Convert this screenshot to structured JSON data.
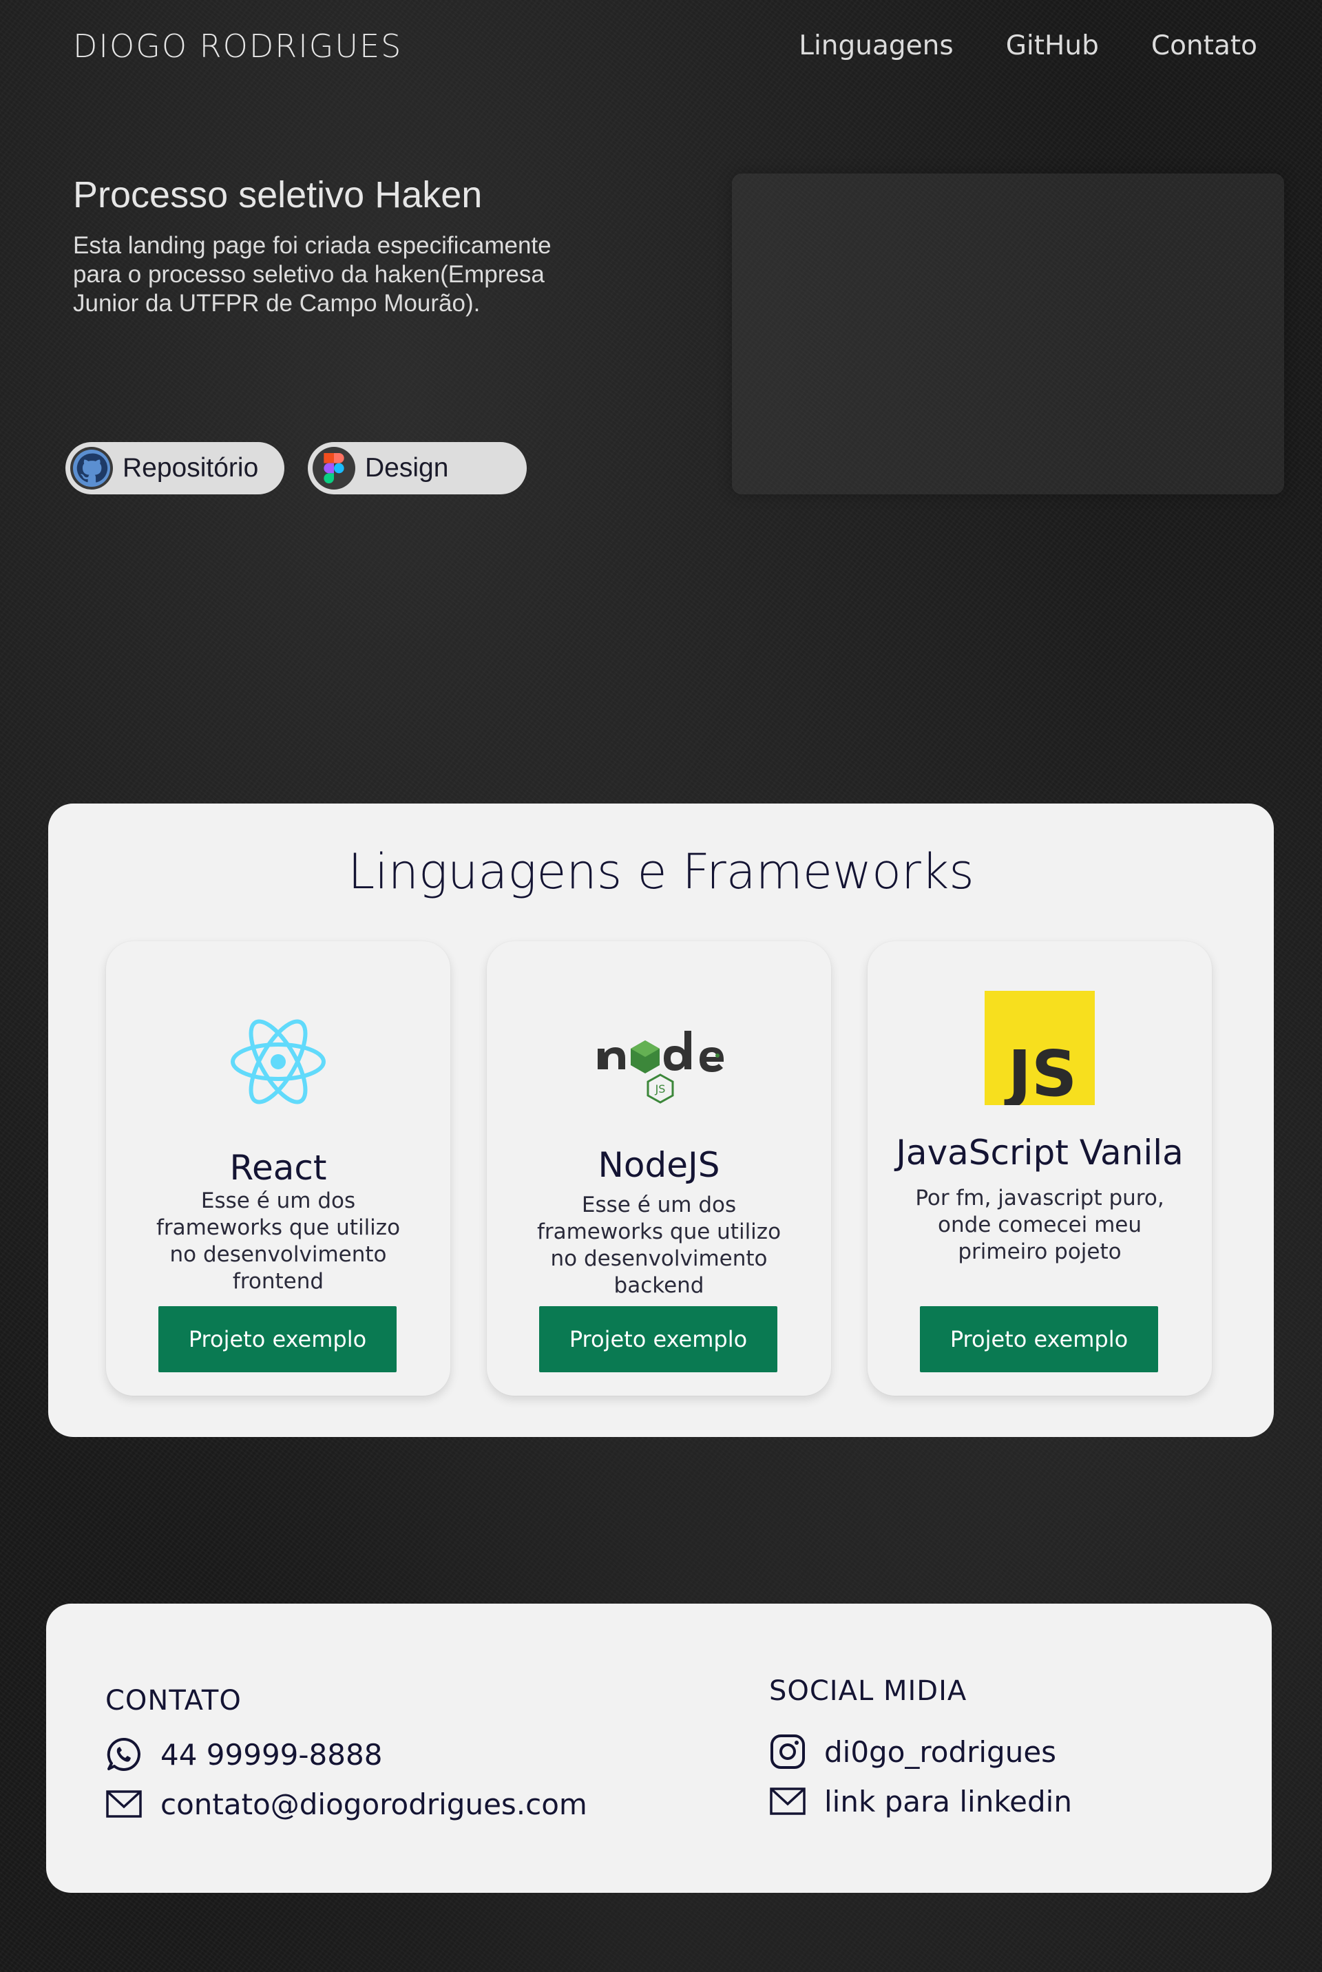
{
  "header": {
    "brand": "DIOGO  RODRIGUES",
    "nav": [
      "Linguagens",
      "GitHub",
      "Contato"
    ]
  },
  "hero": {
    "title": "Processo seletivo Haken",
    "text": "Esta landing page foi criada especificamente para o processo seletivo da haken(Empresa Junior da UTFPR de Campo Mourão).",
    "buttons": [
      {
        "label": "Repositório",
        "icon": "github-icon"
      },
      {
        "label": "Design",
        "icon": "figma-icon"
      }
    ]
  },
  "languages": {
    "title": "Linguagens e Frameworks",
    "cards": [
      {
        "name": "React",
        "icon": "react-icon",
        "description": "Esse é um dos frameworks que utilizo no desenvolvimento frontend",
        "button": "Projeto exemplo"
      },
      {
        "name": "NodeJS",
        "icon": "nodejs-icon",
        "logo_text": "node",
        "description": "Esse é um dos frameworks que utilizo no desenvolvimento backend",
        "button": "Projeto exemplo"
      },
      {
        "name": "JavaScript Vanila",
        "icon": "javascript-icon",
        "logo_text": "JS",
        "description": "Por fm, javascript puro, onde comecei meu primeiro pojeto",
        "button": "Projeto exemplo"
      }
    ]
  },
  "footer": {
    "contact_title": "CONTATO",
    "phone": "44 99999-8888",
    "email": "contato@diogorodrigues.com",
    "social_title": "SOCIAL MIDIA",
    "instagram": "di0go_rodrigues",
    "linkedin": "link para linkedin"
  },
  "colors": {
    "accent": "#0a7a52",
    "card_bg": "#f2f2f2",
    "text_dark": "#141433",
    "react": "#61dafb",
    "js_yellow": "#f7df1e",
    "node_green": "#3c873a"
  }
}
